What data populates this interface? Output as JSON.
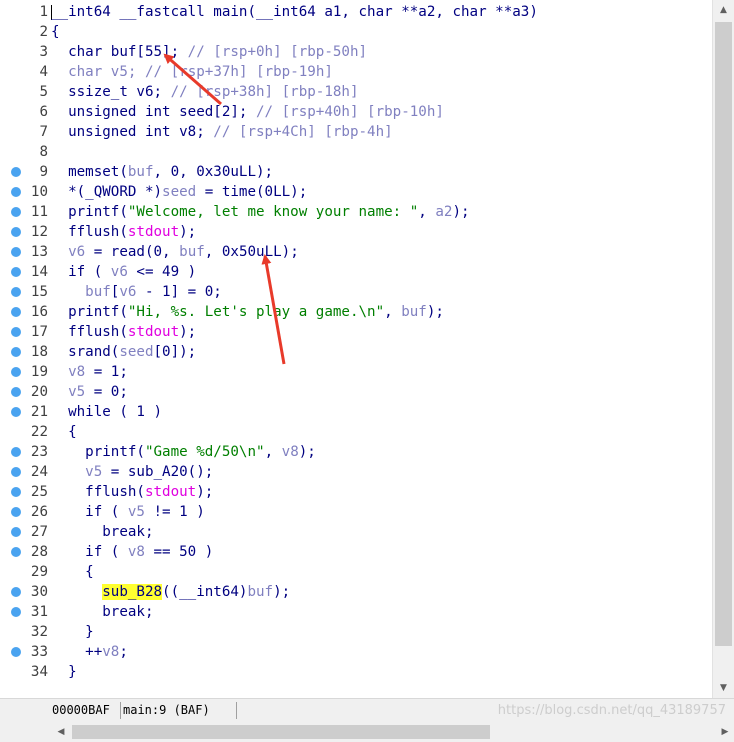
{
  "code_lines": [
    {
      "num": "1",
      "bp": false,
      "tokens": [
        {
          "t": "__int64 __fastcall main(__int64 a1, char **a2, char **a3)",
          "c": "v"
        }
      ]
    },
    {
      "num": "2",
      "bp": false,
      "tokens": [
        {
          "t": "{",
          "c": "v"
        }
      ]
    },
    {
      "num": "3",
      "bp": false,
      "tokens": [
        {
          "t": "  char buf[55]; ",
          "c": "v"
        },
        {
          "t": "// [rsp+0h] [rbp-50h]",
          "c": "c"
        }
      ]
    },
    {
      "num": "4",
      "bp": false,
      "tokens": [
        {
          "t": "  char ",
          "c": "g"
        },
        {
          "t": "v5",
          "c": "g"
        },
        {
          "t": "; ",
          "c": "g"
        },
        {
          "t": "// [rsp+37h] [rbp-19h]",
          "c": "c"
        }
      ]
    },
    {
      "num": "5",
      "bp": false,
      "tokens": [
        {
          "t": "  ssize_t v6; ",
          "c": "v"
        },
        {
          "t": "// [rsp+38h] [rbp-18h]",
          "c": "c"
        }
      ]
    },
    {
      "num": "6",
      "bp": false,
      "tokens": [
        {
          "t": "  unsigned int seed[2]; ",
          "c": "v"
        },
        {
          "t": "// [rsp+40h] [rbp-10h]",
          "c": "c"
        }
      ]
    },
    {
      "num": "7",
      "bp": false,
      "tokens": [
        {
          "t": "  unsigned int v8; ",
          "c": "v"
        },
        {
          "t": "// [rsp+4Ch] [rbp-4h]",
          "c": "c"
        }
      ]
    },
    {
      "num": "8",
      "bp": false,
      "tokens": []
    },
    {
      "num": "9",
      "bp": true,
      "tokens": [
        {
          "t": "  memset(",
          "c": "v"
        },
        {
          "t": "buf",
          "c": "g"
        },
        {
          "t": ", 0, 0x30uLL);",
          "c": "v"
        }
      ]
    },
    {
      "num": "10",
      "bp": true,
      "tokens": [
        {
          "t": "  *(_QWORD *)",
          "c": "v"
        },
        {
          "t": "seed",
          "c": "g"
        },
        {
          "t": " = time(0LL);",
          "c": "v"
        }
      ]
    },
    {
      "num": "11",
      "bp": true,
      "tokens": [
        {
          "t": "  printf(",
          "c": "v"
        },
        {
          "t": "\"Welcome, let me know your name: \"",
          "c": "s"
        },
        {
          "t": ", ",
          "c": "v"
        },
        {
          "t": "a2",
          "c": "g"
        },
        {
          "t": ");",
          "c": "v"
        }
      ]
    },
    {
      "num": "12",
      "bp": true,
      "tokens": [
        {
          "t": "  fflush(",
          "c": "v"
        },
        {
          "t": "stdout",
          "c": "m"
        },
        {
          "t": ");",
          "c": "v"
        }
      ]
    },
    {
      "num": "13",
      "bp": true,
      "tokens": [
        {
          "t": "  ",
          "c": "v"
        },
        {
          "t": "v6",
          "c": "g"
        },
        {
          "t": " = read(0, ",
          "c": "v"
        },
        {
          "t": "buf",
          "c": "g"
        },
        {
          "t": ", 0x50uLL);",
          "c": "v"
        }
      ]
    },
    {
      "num": "14",
      "bp": true,
      "tokens": [
        {
          "t": "  if ( ",
          "c": "v"
        },
        {
          "t": "v6",
          "c": "g"
        },
        {
          "t": " <= 49 )",
          "c": "v"
        }
      ]
    },
    {
      "num": "15",
      "bp": true,
      "tokens": [
        {
          "t": "    ",
          "c": "v"
        },
        {
          "t": "buf",
          "c": "g"
        },
        {
          "t": "[",
          "c": "v"
        },
        {
          "t": "v6",
          "c": "g"
        },
        {
          "t": " - 1] = 0;",
          "c": "v"
        }
      ]
    },
    {
      "num": "16",
      "bp": true,
      "tokens": [
        {
          "t": "  printf(",
          "c": "v"
        },
        {
          "t": "\"Hi, %s. Let's play a game.\\n\"",
          "c": "s"
        },
        {
          "t": ", ",
          "c": "v"
        },
        {
          "t": "buf",
          "c": "g"
        },
        {
          "t": ");",
          "c": "v"
        }
      ]
    },
    {
      "num": "17",
      "bp": true,
      "tokens": [
        {
          "t": "  fflush(",
          "c": "v"
        },
        {
          "t": "stdout",
          "c": "m"
        },
        {
          "t": ");",
          "c": "v"
        }
      ]
    },
    {
      "num": "18",
      "bp": true,
      "tokens": [
        {
          "t": "  srand(",
          "c": "v"
        },
        {
          "t": "seed",
          "c": "g"
        },
        {
          "t": "[0]);",
          "c": "v"
        }
      ]
    },
    {
      "num": "19",
      "bp": true,
      "tokens": [
        {
          "t": "  ",
          "c": "v"
        },
        {
          "t": "v8",
          "c": "g"
        },
        {
          "t": " = 1;",
          "c": "v"
        }
      ]
    },
    {
      "num": "20",
      "bp": true,
      "tokens": [
        {
          "t": "  ",
          "c": "v"
        },
        {
          "t": "v5",
          "c": "g"
        },
        {
          "t": " = 0;",
          "c": "v"
        }
      ]
    },
    {
      "num": "21",
      "bp": true,
      "tokens": [
        {
          "t": "  while ( 1 )",
          "c": "v"
        }
      ]
    },
    {
      "num": "22",
      "bp": false,
      "tokens": [
        {
          "t": "  {",
          "c": "v"
        }
      ]
    },
    {
      "num": "23",
      "bp": true,
      "tokens": [
        {
          "t": "    printf(",
          "c": "v"
        },
        {
          "t": "\"Game %d/50\\n\"",
          "c": "s"
        },
        {
          "t": ", ",
          "c": "v"
        },
        {
          "t": "v8",
          "c": "g"
        },
        {
          "t": ");",
          "c": "v"
        }
      ]
    },
    {
      "num": "24",
      "bp": true,
      "tokens": [
        {
          "t": "    ",
          "c": "v"
        },
        {
          "t": "v5",
          "c": "g"
        },
        {
          "t": " = sub_A20();",
          "c": "v"
        }
      ]
    },
    {
      "num": "25",
      "bp": true,
      "tokens": [
        {
          "t": "    fflush(",
          "c": "v"
        },
        {
          "t": "stdout",
          "c": "m"
        },
        {
          "t": ");",
          "c": "v"
        }
      ]
    },
    {
      "num": "26",
      "bp": true,
      "tokens": [
        {
          "t": "    if ( ",
          "c": "v"
        },
        {
          "t": "v5",
          "c": "g"
        },
        {
          "t": " != 1 )",
          "c": "v"
        }
      ]
    },
    {
      "num": "27",
      "bp": true,
      "tokens": [
        {
          "t": "      break;",
          "c": "v"
        }
      ]
    },
    {
      "num": "28",
      "bp": true,
      "tokens": [
        {
          "t": "    if ( ",
          "c": "v"
        },
        {
          "t": "v8",
          "c": "g"
        },
        {
          "t": " == 50 )",
          "c": "v"
        }
      ]
    },
    {
      "num": "29",
      "bp": false,
      "tokens": [
        {
          "t": "    {",
          "c": "v"
        }
      ]
    },
    {
      "num": "30",
      "bp": true,
      "tokens": [
        {
          "t": "      ",
          "c": "v"
        },
        {
          "t": "sub_B28",
          "c": "h"
        },
        {
          "t": "((__int64)",
          "c": "v"
        },
        {
          "t": "buf",
          "c": "g"
        },
        {
          "t": ");",
          "c": "v"
        }
      ]
    },
    {
      "num": "31",
      "bp": true,
      "tokens": [
        {
          "t": "      break;",
          "c": "v"
        }
      ]
    },
    {
      "num": "32",
      "bp": false,
      "tokens": [
        {
          "t": "    }",
          "c": "v"
        }
      ]
    },
    {
      "num": "33",
      "bp": true,
      "tokens": [
        {
          "t": "    ++",
          "c": "v"
        },
        {
          "t": "v8",
          "c": "g"
        },
        {
          "t": ";",
          "c": "v"
        }
      ]
    },
    {
      "num": "34",
      "bp": false,
      "tokens": [
        {
          "t": "  }",
          "c": "v"
        }
      ]
    }
  ],
  "status": {
    "address": "00000BAF",
    "location": "main:9 (BAF)"
  },
  "watermark": "https://blog.csdn.net/qq_43189757",
  "scroll": {
    "up_icon": "▲",
    "down_icon": "▼",
    "left_icon": "◀",
    "right_icon": "▶"
  },
  "colors": {
    "code": "#000080",
    "local_var": "#8080c0",
    "string": "#007f00",
    "global": "#e000e0",
    "highlight_bg": "#ffff30",
    "breakpoint_dot": "#4aa3f0",
    "annotation_arrow": "#e83a2a"
  }
}
